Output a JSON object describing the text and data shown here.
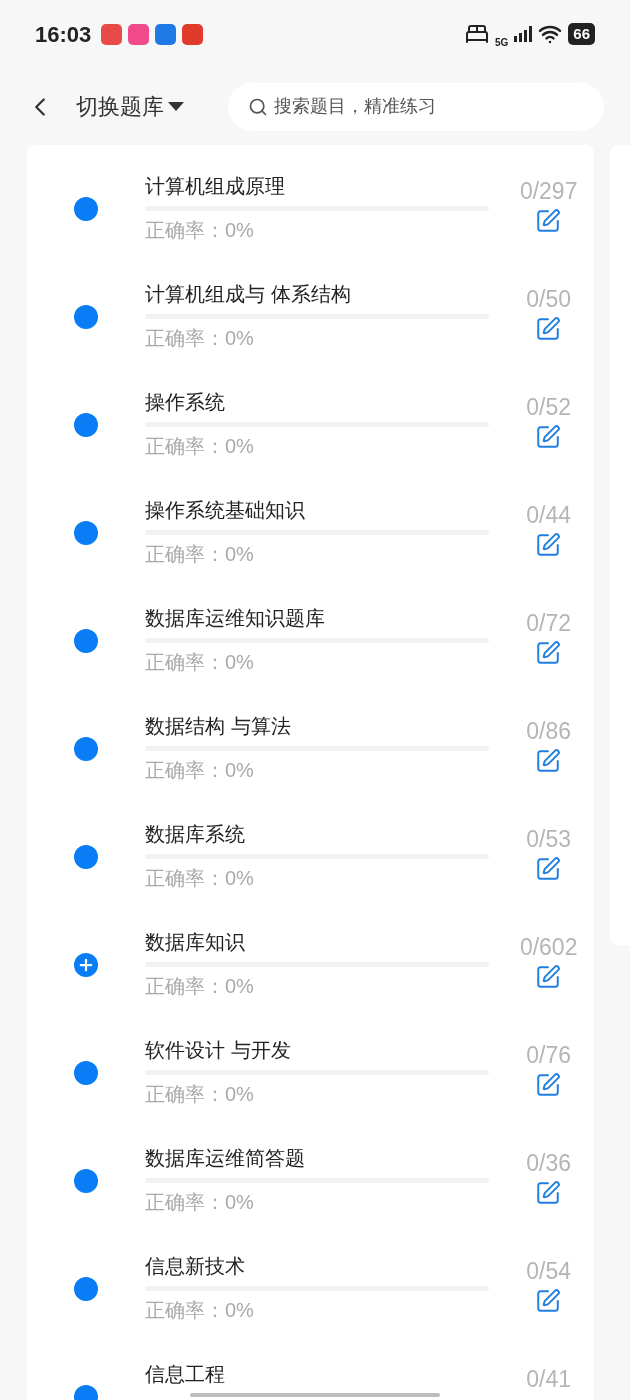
{
  "status_bar": {
    "time": "16:03",
    "network": "5G",
    "battery": "66"
  },
  "header": {
    "title": "切换题库",
    "search": {
      "placeholder": "搜索题目，精准练习"
    }
  },
  "banks": [
    {
      "kind": "dot",
      "name": "计算机组成原理",
      "count": "0/297",
      "accuracy": "正确率：0%"
    },
    {
      "kind": "dot",
      "name": "计算机组成与 体系结构",
      "count": "0/50",
      "accuracy": "正确率：0%"
    },
    {
      "kind": "dot",
      "name": "操作系统",
      "count": "0/52",
      "accuracy": "正确率：0%"
    },
    {
      "kind": "dot",
      "name": "操作系统基础知识",
      "count": "0/44",
      "accuracy": "正确率：0%"
    },
    {
      "kind": "dot",
      "name": "数据库运维知识题库",
      "count": "0/72",
      "accuracy": "正确率：0%"
    },
    {
      "kind": "dot",
      "name": "数据结构 与算法",
      "count": "0/86",
      "accuracy": "正确率：0%"
    },
    {
      "kind": "dot",
      "name": "数据库系统",
      "count": "0/53",
      "accuracy": "正确率：0%"
    },
    {
      "kind": "plus",
      "name": "数据库知识",
      "count": "0/602",
      "accuracy": "正确率：0%"
    },
    {
      "kind": "dot",
      "name": "软件设计 与开发",
      "count": "0/76",
      "accuracy": "正确率：0%"
    },
    {
      "kind": "dot",
      "name": "数据库运维简答题",
      "count": "0/36",
      "accuracy": "正确率：0%"
    },
    {
      "kind": "dot",
      "name": "信息新技术",
      "count": "0/54",
      "accuracy": "正确率：0%"
    },
    {
      "kind": "dot",
      "name": "信息工程",
      "count": "0/41"
    }
  ]
}
